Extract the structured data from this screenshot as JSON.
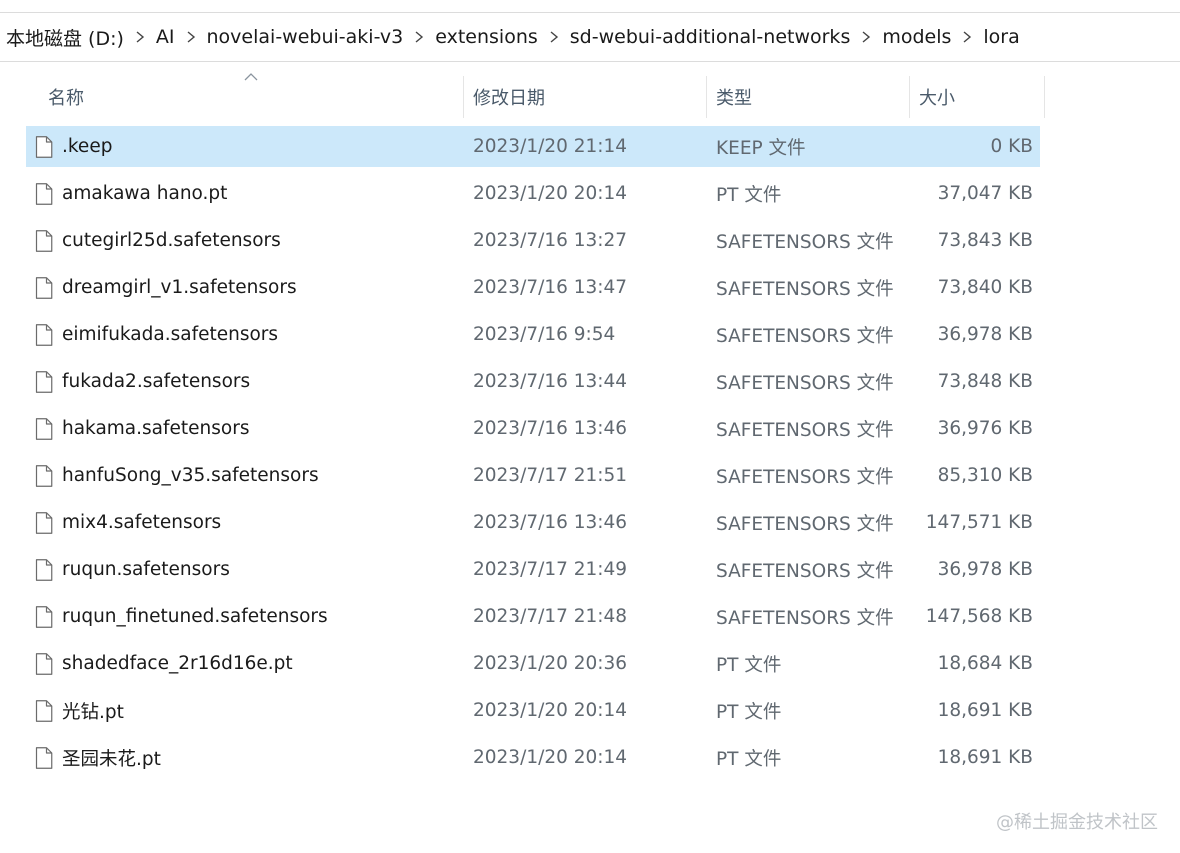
{
  "breadcrumb": {
    "items": [
      {
        "label": "本地磁盘 (D:)"
      },
      {
        "label": "AI"
      },
      {
        "label": "novelai-webui-aki-v3"
      },
      {
        "label": "extensions"
      },
      {
        "label": "sd-webui-additional-networks"
      },
      {
        "label": "models"
      },
      {
        "label": "lora"
      }
    ]
  },
  "columns": {
    "name": "名称",
    "date": "修改日期",
    "type": "类型",
    "size": "大小"
  },
  "files": [
    {
      "name": ".keep",
      "date": "2023/1/20 21:14",
      "type": "KEEP 文件",
      "size": "0 KB",
      "icon": "file-icon",
      "selected": true
    },
    {
      "name": "amakawa hano.pt",
      "date": "2023/1/20 20:14",
      "type": "PT 文件",
      "size": "37,047 KB",
      "icon": "file-icon"
    },
    {
      "name": "cutegirl25d.safetensors",
      "date": "2023/7/16 13:27",
      "type": "SAFETENSORS 文件",
      "size": "73,843 KB",
      "icon": "file-icon"
    },
    {
      "name": "dreamgirl_v1.safetensors",
      "date": "2023/7/16 13:47",
      "type": "SAFETENSORS 文件",
      "size": "73,840 KB",
      "icon": "file-icon"
    },
    {
      "name": "eimifukada.safetensors",
      "date": "2023/7/16 9:54",
      "type": "SAFETENSORS 文件",
      "size": "36,978 KB",
      "icon": "file-icon"
    },
    {
      "name": "fukada2.safetensors",
      "date": "2023/7/16 13:44",
      "type": "SAFETENSORS 文件",
      "size": "73,848 KB",
      "icon": "file-icon"
    },
    {
      "name": "hakama.safetensors",
      "date": "2023/7/16 13:46",
      "type": "SAFETENSORS 文件",
      "size": "36,976 KB",
      "icon": "file-icon"
    },
    {
      "name": "hanfuSong_v35.safetensors",
      "date": "2023/7/17 21:51",
      "type": "SAFETENSORS 文件",
      "size": "85,310 KB",
      "icon": "file-icon"
    },
    {
      "name": "mix4.safetensors",
      "date": "2023/7/16 13:46",
      "type": "SAFETENSORS 文件",
      "size": "147,571 KB",
      "icon": "file-icon"
    },
    {
      "name": "ruqun.safetensors",
      "date": "2023/7/17 21:49",
      "type": "SAFETENSORS 文件",
      "size": "36,978 KB",
      "icon": "file-icon"
    },
    {
      "name": "ruqun_finetuned.safetensors",
      "date": "2023/7/17 21:48",
      "type": "SAFETENSORS 文件",
      "size": "147,568 KB",
      "icon": "file-icon"
    },
    {
      "name": "shadedface_2r16d16e.pt",
      "date": "2023/1/20 20:36",
      "type": "PT 文件",
      "size": "18,684 KB",
      "icon": "file-icon"
    },
    {
      "name": "光钻.pt",
      "date": "2023/1/20 20:14",
      "type": "PT 文件",
      "size": "18,691 KB",
      "icon": "file-icon"
    },
    {
      "name": "圣园未花.pt",
      "date": "2023/1/20 20:14",
      "type": "PT 文件",
      "size": "18,691 KB",
      "icon": "file-icon"
    }
  ],
  "watermark": "@稀土掘金技术社区",
  "colors": {
    "selection": "#cce8fa",
    "header_text": "#4a5a6a",
    "secondary_text": "#606870"
  }
}
